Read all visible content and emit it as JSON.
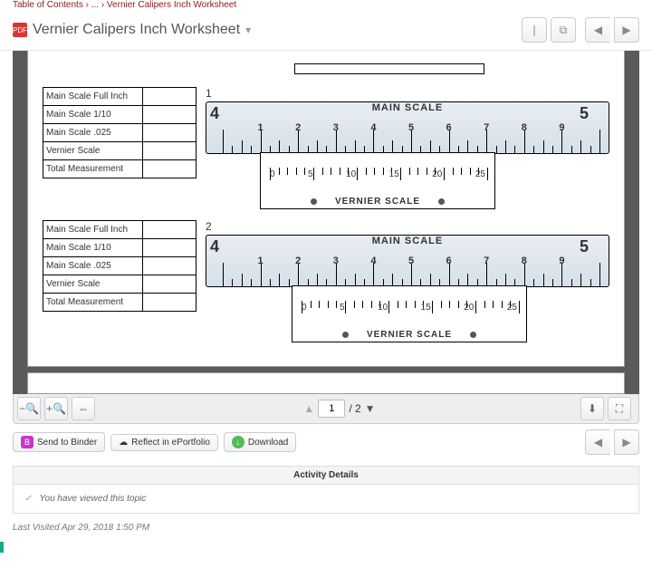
{
  "breadcrumb": "Table of Contents › ... › Vernier Calipers Inch Worksheet",
  "title": "Vernier Calipers Inch Worksheet",
  "toolbar": {
    "page_current": "1",
    "page_total": "2"
  },
  "worksheet": {
    "rows": [
      "Main Scale Full Inch",
      "Main Scale 1/10",
      "Main Scale .025",
      "Vernier Scale",
      "Total Measurement"
    ],
    "problem1_num": "1",
    "problem2_num": "2",
    "main_scale_label": "MAIN SCALE",
    "vernier_scale_label": "VERNIER SCALE",
    "ms_left_big": "4",
    "ms_right_big": "5",
    "ms_nums": [
      "1",
      "2",
      "3",
      "4",
      "5",
      "6",
      "7",
      "8",
      "9",
      "1"
    ],
    "v_nums": [
      "0",
      "5",
      "10",
      "15",
      "20",
      "25"
    ]
  },
  "actions": {
    "binder": "Send to Binder",
    "reflect": "Reflect in ePortfolio",
    "download": "Download"
  },
  "panel": {
    "heading": "Activity Details",
    "viewed": "You have viewed this topic"
  },
  "last_visited": "Last Visited Apr 29, 2018 1:50 PM"
}
